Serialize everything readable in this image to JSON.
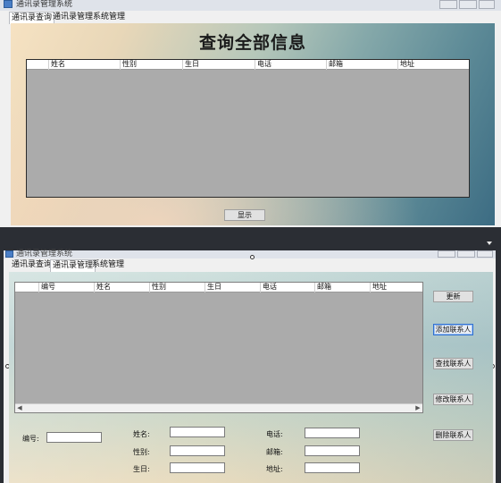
{
  "window1": {
    "title": "通讯录管理系统",
    "tabs": [
      "通讯录查询",
      "通讯录管理",
      "系统管理"
    ],
    "active_tab": 0,
    "heading": "查询全部信息",
    "columns": [
      "姓名",
      "性别",
      "生日",
      "电话",
      "邮箱",
      "地址"
    ],
    "display_button": "显示"
  },
  "window2": {
    "title": "通讯录管理系统",
    "tabs": [
      "通讯录查询",
      "通讯录管理",
      "系统管理"
    ],
    "active_tab": 1,
    "columns": [
      "编号",
      "姓名",
      "性别",
      "生日",
      "电话",
      "邮箱",
      "地址"
    ],
    "buttons": {
      "refresh": "更新",
      "add": "添加联系人",
      "search": "查找联系人",
      "edit": "修改联系人",
      "delete": "删除联系人"
    },
    "form": {
      "id_label": "编号:",
      "name_label": "姓名:",
      "gender_label": "性别:",
      "birthday_label": "生日:",
      "phone_label": "电话:",
      "email_label": "邮箱:",
      "address_label": "地址:"
    }
  }
}
